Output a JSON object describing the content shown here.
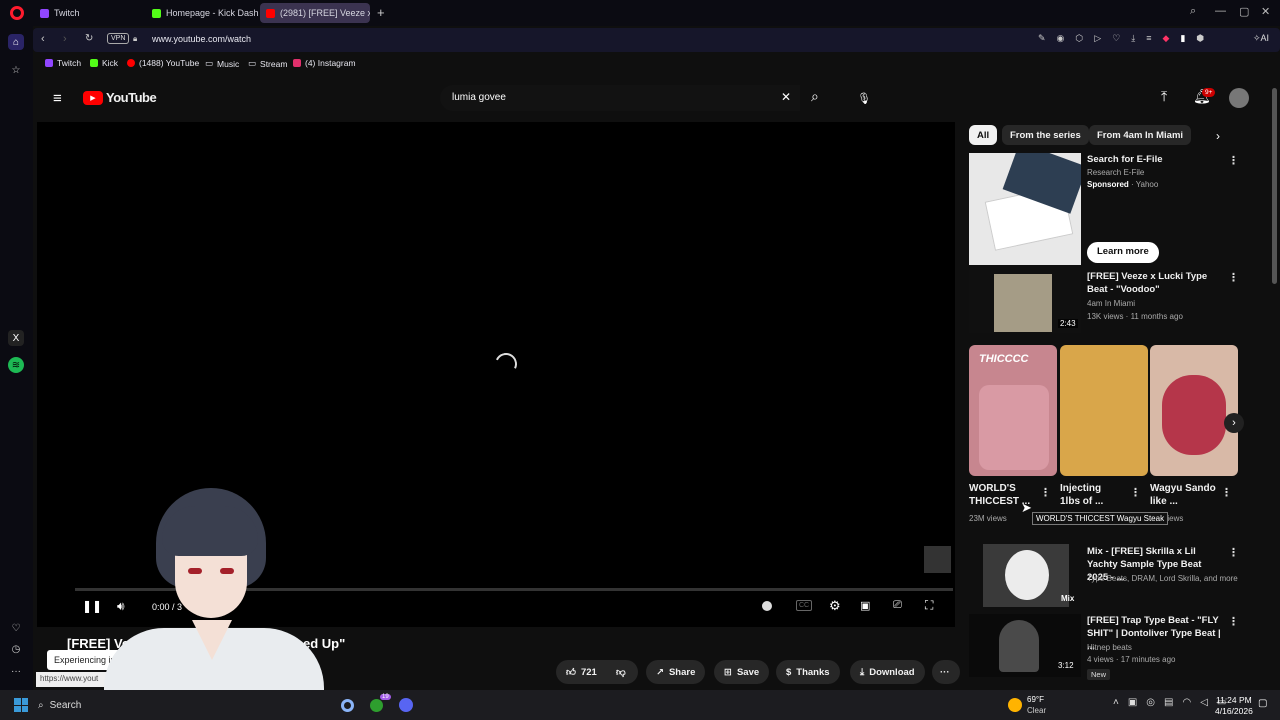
{
  "browser": {
    "tabs": [
      {
        "label": "Twitch",
        "color": "#9146ff"
      },
      {
        "label": "Homepage - Kick Dashbo",
        "color": "#53fc18"
      },
      {
        "label": "(2981) [FREE] Veeze x Luci",
        "color": "#ff0000"
      }
    ],
    "vpn_label": "VPN",
    "url": "www.youtube.com/watch",
    "ai_label": "AI",
    "bookmarks": [
      {
        "label": "Twitch",
        "color": "#9146ff"
      },
      {
        "label": "Kick",
        "color": "#53fc18"
      },
      {
        "label": "(1488) YouTube",
        "color": "#ff0000"
      },
      {
        "label": "Music",
        "color": "#888888"
      },
      {
        "label": "Stream",
        "color": "#888888"
      },
      {
        "label": "(4) Instagram",
        "color": "#e1306c"
      }
    ]
  },
  "youtube": {
    "logo_text": "YouTube",
    "search_value": "lumia govee",
    "notification_badge": "9+",
    "chips": [
      "All",
      "From the series",
      "From 4am In Miami"
    ],
    "player": {
      "time": "0:00 / 3",
      "avatar_tooltip_visible": true
    },
    "video_title": "[FREE] Veeze x L",
    "video_title_end": "\"Gassed Up\"",
    "actions": {
      "likes": "721",
      "share": "Share",
      "save": "Save",
      "thanks": "Thanks",
      "download": "Download"
    },
    "status_text": "Experiencing int",
    "status_url": "https://www.yout",
    "ad": {
      "title": "Search for E-File",
      "channel": "Research E-File",
      "sponsored": "Sponsored",
      "source": "· Yahoo",
      "cta": "Learn more"
    },
    "recommendations": [
      {
        "title": "[FREE] Veeze x Lucki Type Beat - \"Voodoo\"",
        "channel": "4am In Miami",
        "meta": "13K views · 11 months ago",
        "duration": "2:43"
      },
      {
        "title": "Mix - [FREE] Skrilla x Lil Yachty Sample Type Beat 2025 - ...",
        "channel": "Type Beats, DRAM, Lord Skrilla, and more",
        "meta": "",
        "duration": "Mix"
      },
      {
        "title": "[FREE] Trap Type Beat - \"FLY SHIT\" | Dontoliver Type Beat | ...",
        "channel": "Hitnep beats",
        "meta": "4 views · 17 minutes ago",
        "duration": "3:12",
        "badge": "New"
      }
    ],
    "shorts": [
      {
        "title": "WORLD'S THICCEST ...",
        "views": "23M views",
        "overlay": "THICCCC"
      },
      {
        "title": "Injecting 1lbs of ...",
        "views": ""
      },
      {
        "title": "Wagyu Sando like ...",
        "views": "1M views"
      }
    ],
    "shorts_tooltip": "WORLD'S THICCEST Wagyu Steak"
  },
  "taskbar": {
    "search_label": "Search",
    "weather_temp": "69°F",
    "weather_cond": "Clear",
    "time": "11:24 PM",
    "date": "4/16/2026",
    "badge": "19"
  }
}
